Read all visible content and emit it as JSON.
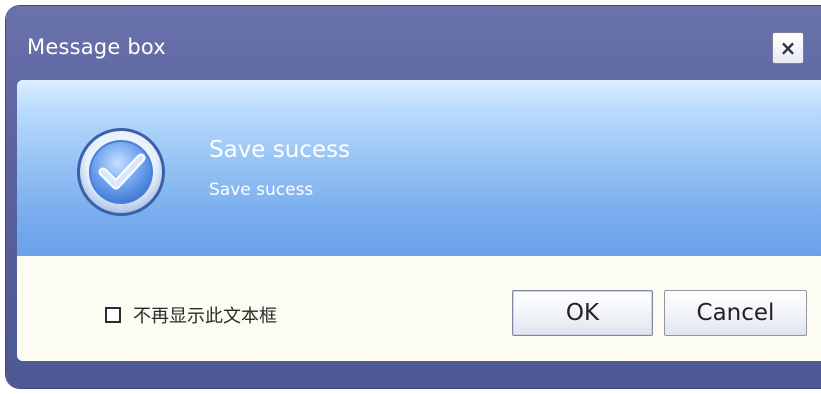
{
  "window": {
    "title": "Message box",
    "close_label": "×"
  },
  "message": {
    "icon": "check-circle-icon",
    "title": "Save sucess",
    "body": "Save sucess"
  },
  "footer": {
    "dont_show_label": "不再显示此文本框",
    "dont_show_checked": false,
    "ok_label": "OK",
    "cancel_label": "Cancel"
  },
  "colors": {
    "frame": "#5a63a0",
    "banner_top": "#dcefff",
    "banner_bottom": "#6b9fe9",
    "footer_bg": "#fdfcf3"
  }
}
